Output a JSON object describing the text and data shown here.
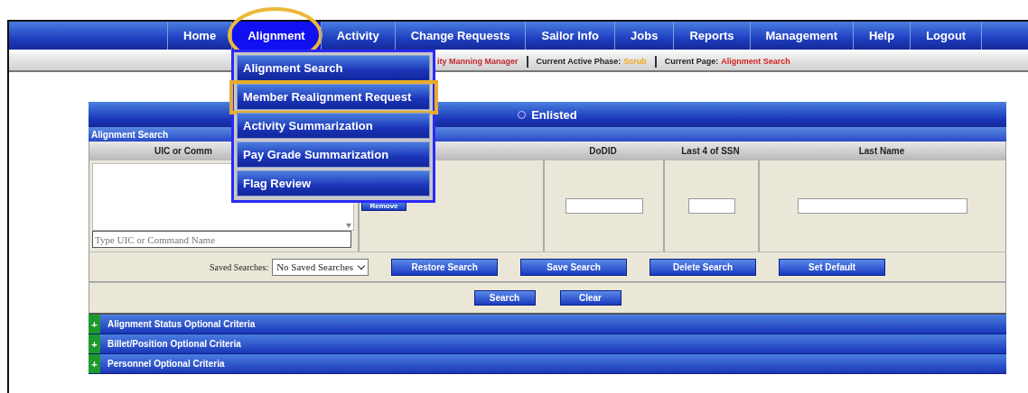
{
  "nav": {
    "items": [
      {
        "label": "Home",
        "selected": false,
        "annotated": false
      },
      {
        "label": "Alignment",
        "selected": true,
        "annotated": true
      },
      {
        "label": "Activity",
        "selected": false,
        "annotated": false
      },
      {
        "label": "Change Requests",
        "selected": false,
        "annotated": false
      },
      {
        "label": "Sailor Info",
        "selected": false,
        "annotated": false
      },
      {
        "label": "Jobs",
        "selected": false,
        "annotated": false
      },
      {
        "label": "Reports",
        "selected": false,
        "annotated": false
      },
      {
        "label": "Management",
        "selected": false,
        "annotated": false
      },
      {
        "label": "Help",
        "selected": false,
        "annotated": false
      },
      {
        "label": "Logout",
        "selected": false,
        "annotated": false
      }
    ]
  },
  "dropdown": {
    "items": [
      {
        "label": "Alignment Search",
        "annotated": false
      },
      {
        "label": "Member Realignment Request",
        "annotated": true
      },
      {
        "label": "Activity Summarization",
        "annotated": false
      },
      {
        "label": "Pay Grade Summarization",
        "annotated": false
      },
      {
        "label": "Flag Review",
        "annotated": false
      }
    ]
  },
  "info_bar": {
    "items": [
      {
        "value": "ity Manning Manager",
        "color": "#c0282c"
      },
      {
        "label": "Current Active Phase:",
        "value": "Scrub",
        "color": "#f0a818"
      },
      {
        "label": "Current Page:",
        "value": "Alignment Search",
        "color": "#d02020"
      }
    ]
  },
  "panel": {
    "radio": {
      "label": "Enlisted",
      "selected": false
    },
    "section_title": "Alignment Search",
    "columns": [
      "UIC or Comm",
      "DoDID",
      "Last 4 of SSN",
      "Last Name"
    ],
    "uic_input": {
      "placeholder": "Type UIC or Command Name"
    },
    "remove_button": "Remove",
    "saved_searches": {
      "label": "Saved Searches:",
      "value": "No Saved Searches"
    },
    "saved_buttons": [
      "Restore Search",
      "Save Search",
      "Delete Search",
      "Set Default"
    ],
    "search_buttons": [
      "Search",
      "Clear"
    ],
    "criteria": [
      {
        "label": "Alignment Status Optional Criteria",
        "toggle": "+"
      },
      {
        "label": "Billet/Position Optional Criteria",
        "toggle": "+"
      },
      {
        "label": "Personnel Optional Criteria",
        "toggle": "+"
      }
    ]
  }
}
